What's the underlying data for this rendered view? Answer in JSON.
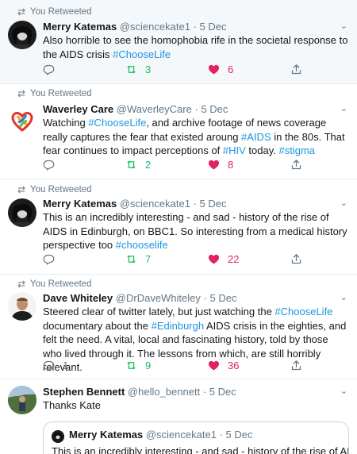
{
  "colors": {
    "link": "#1b95e0",
    "retweet": "#17bf63",
    "like": "#e0245e",
    "muted": "#657786"
  },
  "tweets": [
    {
      "retweet_label": "You Retweeted",
      "name": "Merry Katemas",
      "handle": "@sciencekate1",
      "dot": "·",
      "date": "5 Dec",
      "text_1": "Also horrible to see the homophobia rife in the societal response to the AIDS crisis ",
      "tag_1": "#ChooseLife",
      "retweets": "3",
      "likes": "6"
    },
    {
      "retweet_label": "You Retweeted",
      "name": "Waverley Care",
      "handle": "@WaverleyCare",
      "dot": "·",
      "date": "5 Dec",
      "text_1": "Watching ",
      "tag_1": "#ChooseLife",
      "text_2": ", and archive footage of news coverage really captures the fear that existed aroung ",
      "tag_2": "#AIDS",
      "text_3": " in the 80s. That fear continues to impact perceptions of ",
      "tag_3": "#HIV",
      "text_4": " today. ",
      "tag_4": "#stigma",
      "retweets": "2",
      "likes": "8"
    },
    {
      "retweet_label": "You Retweeted",
      "name": "Merry Katemas",
      "handle": "@sciencekate1",
      "dot": "·",
      "date": "5 Dec",
      "text_1": "This is an incredibly interesting - and sad - history of the rise of AIDS in Edinburgh, on BBC1. So interesting from a medical history perspective too ",
      "tag_1": "#chooselife",
      "retweets": "7",
      "likes": "22"
    },
    {
      "retweet_label": "You Retweeted",
      "name": "Dave Whiteley",
      "handle": "@DrDaveWhiteley",
      "dot": "·",
      "date": "5 Dec",
      "text_1": "Steered clear of twitter lately, but just watching the ",
      "tag_1": "#ChooseLife",
      "text_2": " documentary about the ",
      "tag_2": "#Edinburgh",
      "text_3": " AIDS crisis in the eighties, and felt the need. A vital, local and fascinating history, told by those who lived through it. The lessons from which, are still horribly relevant.",
      "replies": "1",
      "retweets": "9",
      "likes": "36"
    },
    {
      "name": "Stephen Bennett",
      "handle": "@hello_bennett",
      "dot": "·",
      "date": "5 Dec",
      "text_1": "Thanks Kate",
      "quote": {
        "name": "Merry Katemas",
        "handle": "@sciencekate1",
        "dot": "·",
        "date": "5 Dec",
        "text": "This is an incredibly interesting - and sad - history of the rise of AIDS"
      }
    }
  ]
}
